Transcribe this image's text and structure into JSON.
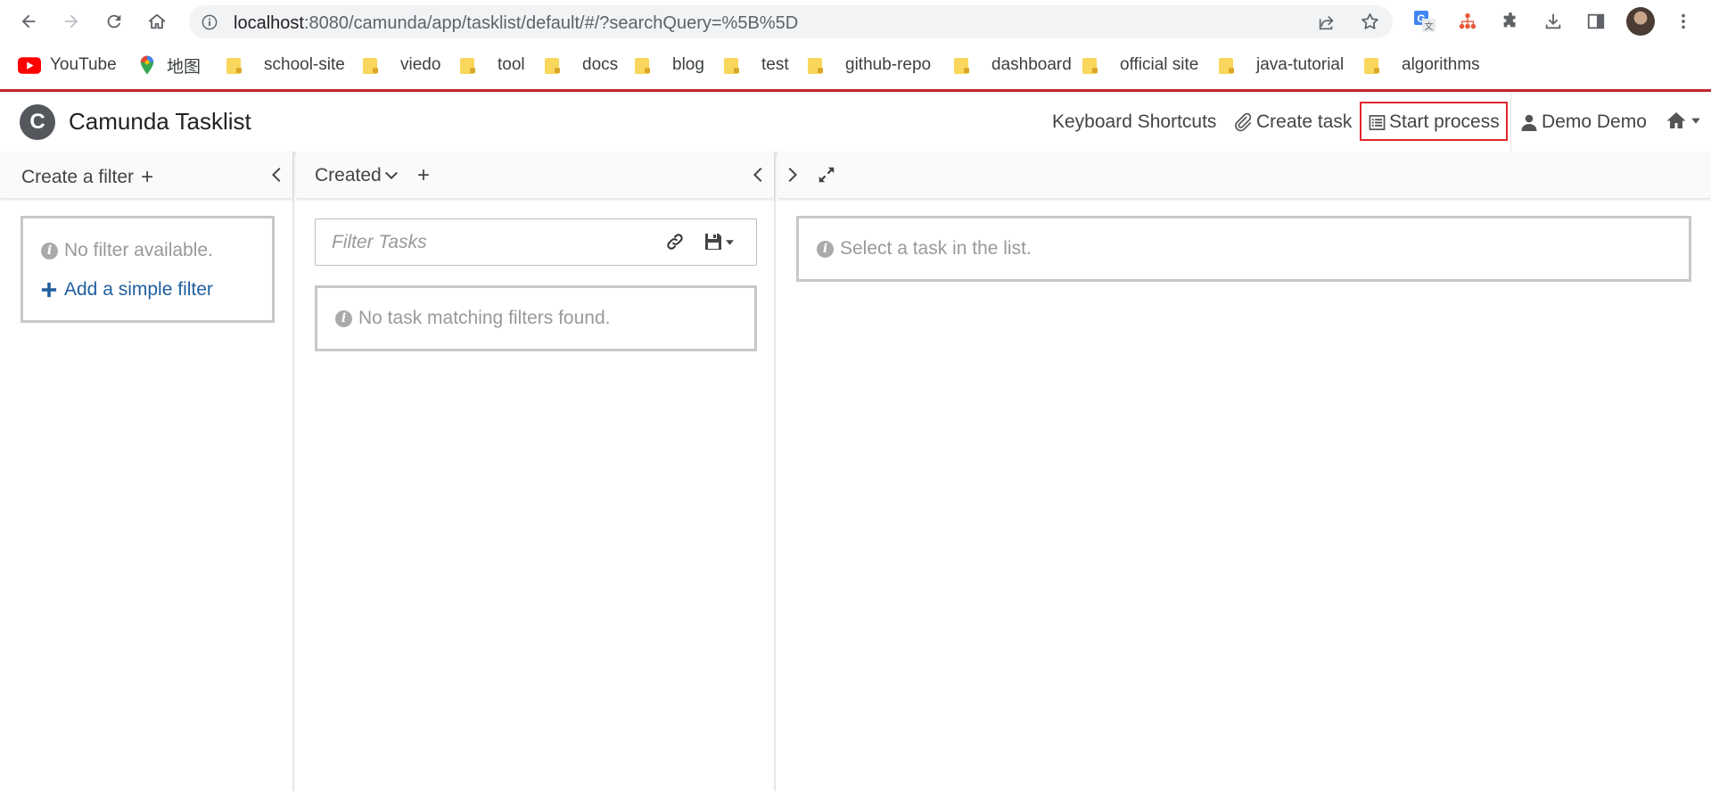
{
  "browser": {
    "url_host": "localhost",
    "url_rest": ":8080/camunda/app/tasklist/default/#/?searchQuery=%5B%5D"
  },
  "bookmarks": [
    {
      "label": "YouTube",
      "icon": "youtube-icon"
    },
    {
      "label": "地图",
      "icon": "maps-icon"
    },
    {
      "label": "school-site",
      "icon": "folder-icon"
    },
    {
      "label": "viedo",
      "icon": "folder-icon"
    },
    {
      "label": "tool",
      "icon": "folder-icon"
    },
    {
      "label": "docs",
      "icon": "folder-icon"
    },
    {
      "label": "blog",
      "icon": "folder-icon"
    },
    {
      "label": "test",
      "icon": "folder-icon"
    },
    {
      "label": "github-repo",
      "icon": "folder-icon"
    },
    {
      "label": "dashboard",
      "icon": "folder-icon"
    },
    {
      "label": "official site",
      "icon": "folder-icon"
    },
    {
      "label": "java-tutorial",
      "icon": "folder-icon"
    },
    {
      "label": "algorithms",
      "icon": "folder-icon"
    }
  ],
  "header": {
    "logo_letter": "C",
    "title": "Camunda Tasklist",
    "keyboard_shortcuts": "Keyboard Shortcuts",
    "create_task": "Create task",
    "start_process": "Start process",
    "user": "Demo Demo"
  },
  "filters_panel": {
    "create_filter": "Create a filter",
    "plus": "+",
    "empty_text": "No filter available.",
    "add_filter": "Add a simple filter"
  },
  "list_panel": {
    "sort_label": "Created",
    "plus": "+",
    "search_placeholder": "Filter Tasks",
    "empty_text": "No task matching filters found."
  },
  "detail_panel": {
    "empty_text": "Select a task in the list."
  },
  "colors": {
    "accent_red": "#c1272d",
    "highlight_box": "#e0262b",
    "link_blue": "#1f5f9e"
  }
}
